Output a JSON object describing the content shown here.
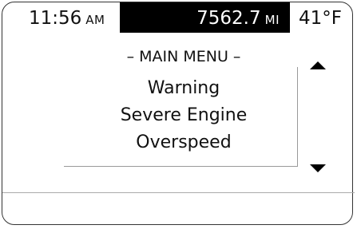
{
  "status_bar": {
    "time": "11:56",
    "time_period": "AM",
    "odometer": "7562.7",
    "odometer_unit": "MI",
    "temperature": "41°F"
  },
  "menu": {
    "title": "– MAIN MENU –",
    "message_lines": [
      "Warning",
      "Severe Engine",
      "Overspeed"
    ]
  },
  "scroll": {
    "up_icon": "triangle-up-icon",
    "down_icon": "triangle-down-icon"
  },
  "colors": {
    "odometer_background": "#000000",
    "odometer_text": "#ffffff",
    "text": "#111111",
    "background": "#ffffff"
  }
}
